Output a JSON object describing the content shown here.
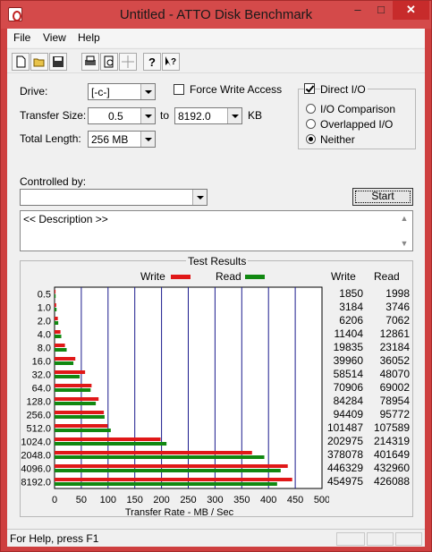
{
  "window": {
    "title": "Untitled - ATTO Disk Benchmark",
    "minimize": "–",
    "maximize": "□",
    "close": "✕"
  },
  "menu": [
    "File",
    "View",
    "Help"
  ],
  "toolbar": {
    "icons": [
      "new-file-icon",
      "open-folder-icon",
      "save-icon",
      "print-icon",
      "print-preview-icon",
      "move-icon",
      "help-icon",
      "context-help-icon"
    ]
  },
  "settings": {
    "drive_label": "Drive:",
    "drive_value": "[-c-]",
    "transfer_size_label": "Transfer Size:",
    "transfer_from": "0.5",
    "to_label": "to",
    "transfer_to": "8192.0",
    "unit": "KB",
    "total_length_label": "Total Length:",
    "total_length": "256 MB",
    "force_write_label": "Force Write Access",
    "force_write_checked": false,
    "direct_io_label": "Direct I/O",
    "direct_io_checked": true,
    "io_options": [
      {
        "label": "I/O Comparison",
        "checked": false
      },
      {
        "label": "Overlapped I/O",
        "checked": false
      },
      {
        "label": "Neither",
        "checked": true
      }
    ]
  },
  "controlled_by": {
    "label": "Controlled by:",
    "value": ""
  },
  "start_button": "Start",
  "description": "<< Description >>",
  "status": "For Help, press F1",
  "chart_data": {
    "type": "bar",
    "orientation": "horizontal",
    "title": "Test Results",
    "xlabel": "Transfer Rate - MB / Sec",
    "xlim": [
      0,
      500
    ],
    "xticks": [
      "0",
      "50",
      "100",
      "150",
      "200",
      "250",
      "300",
      "350",
      "400",
      "450",
      "500"
    ],
    "categories": [
      "0.5",
      "1.0",
      "2.0",
      "4.0",
      "8.0",
      "16.0",
      "32.0",
      "64.0",
      "128.0",
      "256.0",
      "512.0",
      "1024.0",
      "2048.0",
      "4096.0",
      "8192.0"
    ],
    "series": [
      {
        "name": "Write",
        "color": "#e01818",
        "values": [
          1.8,
          3.1,
          6.1,
          11.1,
          19.4,
          38.8,
          57.1,
          69.2,
          82.3,
          92.2,
          99.1,
          198.2,
          369.2,
          436.0,
          444.3
        ]
      },
      {
        "name": "Read",
        "color": "#118811",
        "values": [
          2.0,
          3.7,
          6.9,
          12.6,
          22.6,
          35.2,
          46.9,
          67.4,
          77.1,
          93.5,
          105.1,
          209.3,
          392.2,
          422.8,
          416.1
        ]
      }
    ],
    "grid": true,
    "legend": "top-center",
    "table": {
      "headers": [
        "Write",
        "Read"
      ],
      "rows": [
        [
          "1850",
          "1998"
        ],
        [
          "3184",
          "3746"
        ],
        [
          "6206",
          "7062"
        ],
        [
          "11404",
          "12861"
        ],
        [
          "19835",
          "23184"
        ],
        [
          "39960",
          "36052"
        ],
        [
          "58514",
          "48070"
        ],
        [
          "70906",
          "69002"
        ],
        [
          "84284",
          "78954"
        ],
        [
          "94409",
          "95772"
        ],
        [
          "101487",
          "107589"
        ],
        [
          "202975",
          "214319"
        ],
        [
          "378078",
          "401649"
        ],
        [
          "446329",
          "432960"
        ],
        [
          "454975",
          "426088"
        ]
      ]
    }
  }
}
